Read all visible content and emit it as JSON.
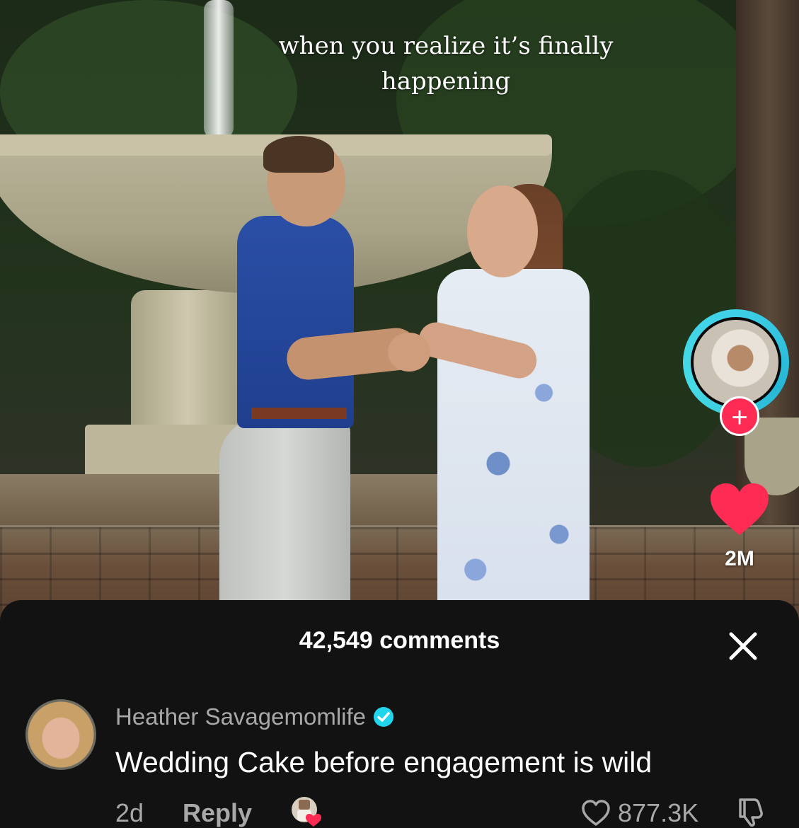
{
  "video": {
    "caption": "when you realize it’s finally happening"
  },
  "rail": {
    "creator_avatar_icon": "creator-avatar",
    "follow_icon": "plus-icon",
    "follow_symbol": "+",
    "like_icon": "heart-icon",
    "like_count": "2M",
    "like_color": "#fe2c55"
  },
  "comments": {
    "title": "42,549 comments",
    "close_icon": "close-icon",
    "items": [
      {
        "username": "Heather Savagemomlife",
        "verified": true,
        "text": "Wedding Cake before engagement is wild",
        "age": "2d",
        "reply_label": "Reply",
        "creator_liked": true,
        "like_count": "877.3K"
      }
    ]
  },
  "colors": {
    "accent": "#fe2c55",
    "sheet_background": "#121212",
    "verified": "#20d5ec"
  }
}
